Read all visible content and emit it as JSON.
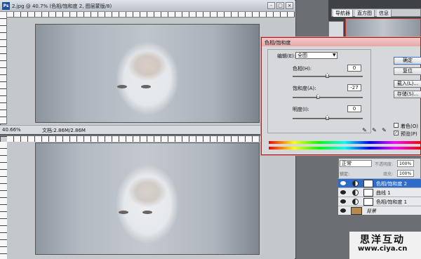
{
  "document": {
    "title": "2.jpg @ 40.7% (色相/饱和度 2, 图层蒙版/8)",
    "ps_badge": "Ps",
    "zoom": "40.66%",
    "docsize": "文档:2.86M/2.86M",
    "win_min": "-",
    "win_max": "□",
    "win_close": "×"
  },
  "navigator": {
    "tabs": [
      "导航器",
      "直方图",
      "信息"
    ]
  },
  "dialog": {
    "title": "色相/饱和度",
    "edit_label": "编辑(E):",
    "edit_value": "全图",
    "hue_label": "色相(H):",
    "hue_value": "0",
    "sat_label": "饱和度(A):",
    "sat_value": "-27",
    "light_label": "明度(I):",
    "light_value": "0",
    "btn_ok": "确定",
    "btn_reset": "复位",
    "btn_load": "载入(L)...",
    "btn_save": "存储(S)...",
    "colorize_label": "着色(O)",
    "preview_label": "预览(P)",
    "preview_checked": "✓",
    "dropper_glyphs": [
      "✎",
      "✎",
      "✎"
    ],
    "hue_level": 0,
    "sat_level": -27,
    "light_level": 0
  },
  "layers": {
    "blend_mode": "正常",
    "opacity_label": "不透明度:",
    "opacity_value": "100%",
    "lock_label": "锁定:",
    "fill_label": "填充:",
    "fill_value": "100%",
    "items": [
      {
        "name": "色相/饱和度 2",
        "selected": true
      },
      {
        "name": "曲线 1",
        "selected": false
      },
      {
        "name": "色相/饱和度 1",
        "selected": false
      },
      {
        "name": "背景",
        "selected": false
      }
    ]
  },
  "watermark": {
    "text": "思洋互动",
    "url": "www.ciya.cn"
  },
  "colors": {
    "selection": "#2f6bc9",
    "dialog_title": "#e7a7a7"
  }
}
